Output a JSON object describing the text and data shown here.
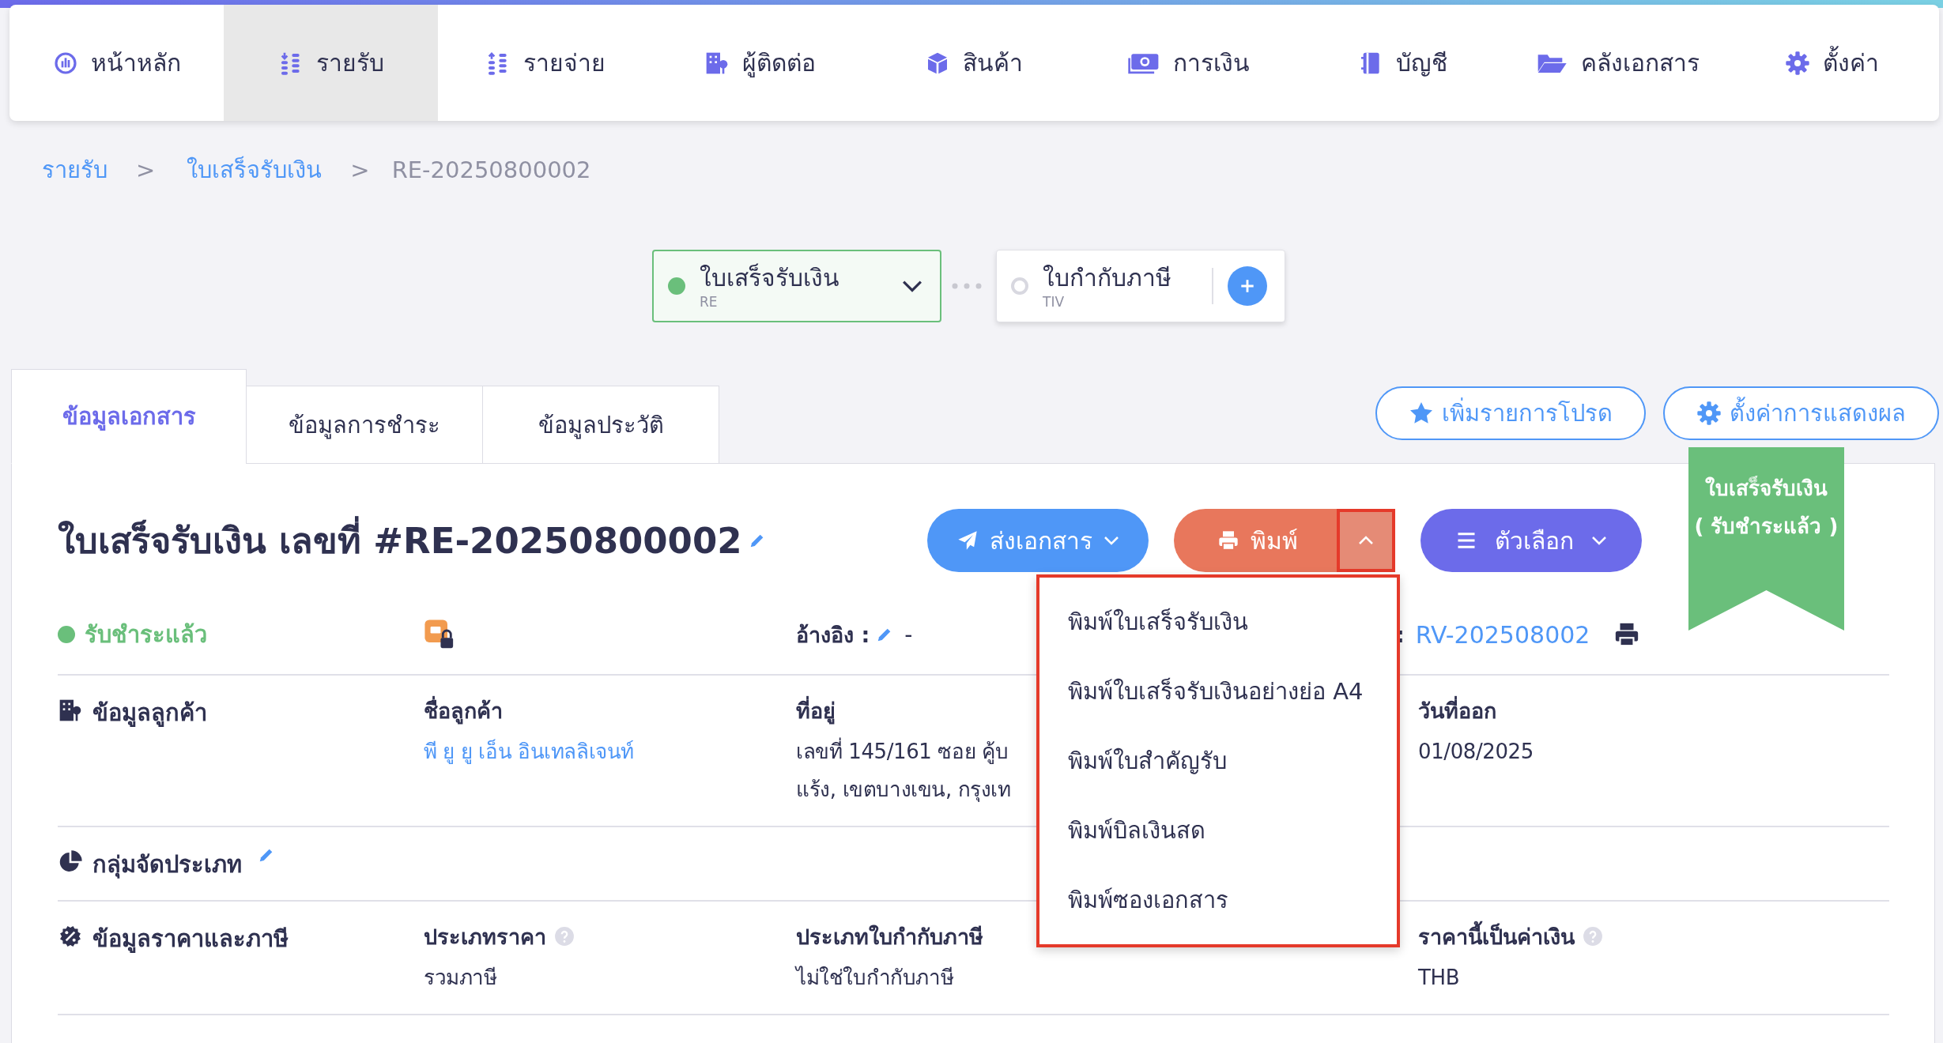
{
  "nav": [
    {
      "label": "หน้าหลัก",
      "selected": false
    },
    {
      "label": "รายรับ",
      "selected": true
    },
    {
      "label": "รายจ่าย",
      "selected": false
    },
    {
      "label": "ผู้ติดต่อ",
      "selected": false
    },
    {
      "label": "สินค้า",
      "selected": false
    },
    {
      "label": "การเงิน",
      "selected": false
    },
    {
      "label": "บัญชี",
      "selected": false
    },
    {
      "label": "คลังเอกสาร",
      "selected": false
    },
    {
      "label": "ตั้งค่า",
      "selected": false
    }
  ],
  "breadcrumb": {
    "links": [
      "รายรับ",
      "ใบเสร็จรับเงิน"
    ],
    "separators": [
      ">",
      ">"
    ],
    "current": "RE-20250800002"
  },
  "doc_flow": [
    {
      "title": "ใบเสร็จรับเงิน",
      "code": "RE",
      "current": true
    },
    {
      "title": "ใบกำกับภาษี",
      "code": "TIV",
      "current": false
    }
  ],
  "tabs": [
    {
      "label": "ข้อมูลเอกสาร",
      "selected": true
    },
    {
      "label": "ข้อมูลการชำระ",
      "selected": false
    },
    {
      "label": "ข้อมูลประวัติ",
      "selected": false
    }
  ],
  "actions": [
    "เพิ่มรายการโปรด",
    "ตั้งค่าการแสดงผล"
  ],
  "document": {
    "title": "ใบเสร็จรับเงิน เลขที่ #RE-20250800002",
    "buttons": [
      {
        "label": "ส่งเอกสาร",
        "kind": "send"
      },
      {
        "label": "พิมพ์",
        "kind": "print",
        "menu_highlighted": true
      },
      {
        "label": "ตัวเลือก",
        "kind": "options"
      }
    ],
    "ribbon": [
      "ใบเสร็จรับเงิน",
      "( รับชำระแล้ว )"
    ],
    "status": "รับชำระแล้ว",
    "locked": true,
    "reference": {
      "label": "อ้างอิง :",
      "value": "-"
    },
    "source": {
      "label": ":",
      "value": "RV-202508002"
    }
  },
  "sections": [
    {
      "title": "ข้อมูลลูกค้า",
      "editable": false,
      "fields": [
        {
          "label": "ชื่อลูกค้า",
          "lines": [
            "พี ยู ยู เอ็น อินเทลลิเจนท์"
          ],
          "link": true,
          "help": false
        },
        {
          "label": "ที่อยู่",
          "lines": [
            "เลขที่ 145/161 ซอย คู้บ",
            "แร้ง, เขตบางเขน, กรุงเท"
          ],
          "link": false,
          "help": false
        },
        {
          "label": "วันที่ออก",
          "lines": [
            "01/08/2025"
          ],
          "link": false,
          "help": false
        }
      ]
    },
    {
      "title": "กลุ่มจัดประเภท",
      "editable": true
    },
    {
      "title": "ข้อมูลราคาและภาษี",
      "editable": false,
      "fields": [
        {
          "label": "ประเภทราคา",
          "lines": [
            "รวมภาษี"
          ],
          "link": false,
          "help": true
        },
        {
          "label": "ประเภทใบกำกับภาษี",
          "lines": [
            "ไม่ใช่ใบกำกับภาษี"
          ],
          "link": false,
          "help": false
        },
        {
          "label": "ราคานี้เป็นค่าเงิน",
          "lines": [
            "THB"
          ],
          "link": false,
          "help": true
        }
      ]
    }
  ],
  "print_menu": {
    "open": true,
    "highlighted": true,
    "items": [
      "พิมพ์ใบเสร็จรับเงิน",
      "พิมพ์ใบเสร็จรับเงินอย่างย่อ A4",
      "พิมพ์ใบสำคัญรับ",
      "พิมพ์บิลเงินสด",
      "พิมพ์ซองเอกสาร"
    ]
  }
}
